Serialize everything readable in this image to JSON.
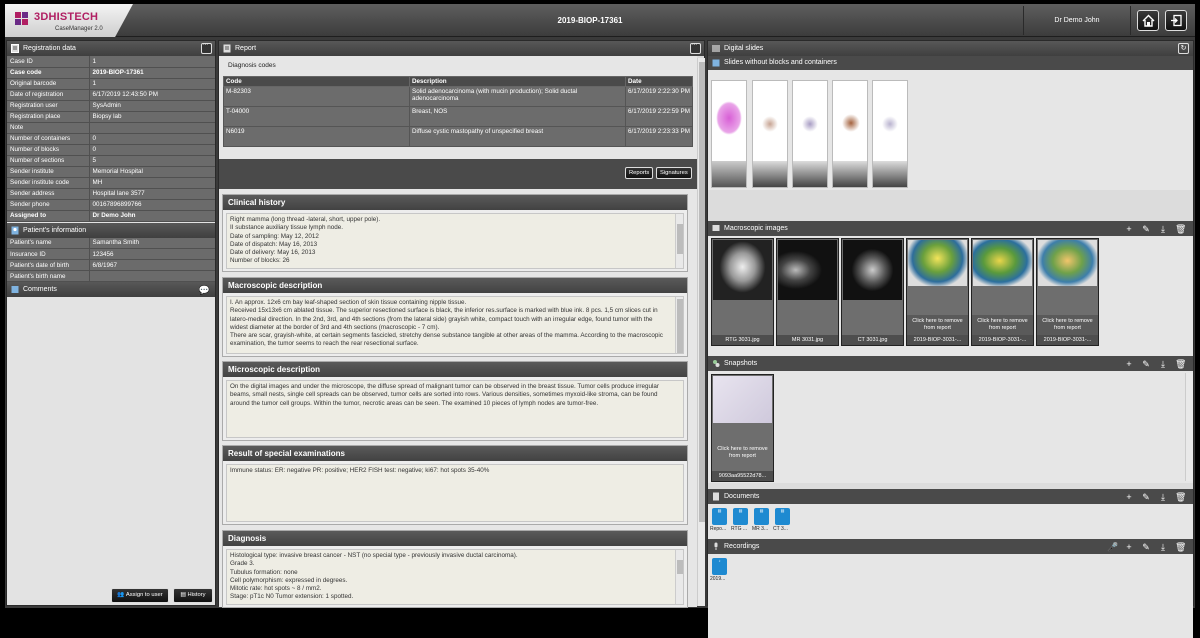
{
  "app": {
    "brand": "3DHISTECH",
    "product": "CaseManager 2.0",
    "case_title": "2019-BIOP-17361",
    "user": "Dr Demo John"
  },
  "registration": {
    "title": "Registration data",
    "rows": [
      {
        "k": "Case ID",
        "v": "1"
      },
      {
        "k": "Case code",
        "v": "2019-BIOP-17361",
        "bold": true
      },
      {
        "k": "Original barcode",
        "v": "1"
      },
      {
        "k": "Date of registration",
        "v": "6/17/2019 12:43:50 PM"
      },
      {
        "k": "Registration user",
        "v": "SysAdmin"
      },
      {
        "k": "Registration place",
        "v": "Biopsy lab"
      },
      {
        "k": "Note",
        "v": ""
      },
      {
        "k": "Number of containers",
        "v": "0"
      },
      {
        "k": "Number of blocks",
        "v": "0"
      },
      {
        "k": "Number of sections",
        "v": "5"
      },
      {
        "k": "Sender institute",
        "v": "Memorial Hospital"
      },
      {
        "k": "Sender institute code",
        "v": "MH"
      },
      {
        "k": "Sender address",
        "v": "Hospital lane 3577"
      },
      {
        "k": "Sender phone",
        "v": "00167896899766"
      },
      {
        "k": "Assigned to",
        "v": "Dr Demo John",
        "bold": true
      }
    ]
  },
  "patient": {
    "title": "Patient's information",
    "rows": [
      {
        "k": "Patient's name",
        "v": "Samantha Smith"
      },
      {
        "k": "Insurance ID",
        "v": "123456"
      },
      {
        "k": "Patient's date of birth",
        "v": "6/8/1967"
      },
      {
        "k": "Patient's birth name",
        "v": ""
      }
    ]
  },
  "comments": {
    "title": "Comments"
  },
  "bottom_buttons": {
    "assign": "Assign to user",
    "history": "History"
  },
  "report": {
    "title": "Report",
    "diag_codes_title": "Diagnosis codes",
    "columns": [
      "Code",
      "Description",
      "Date"
    ],
    "codes": [
      {
        "code": "M-82303",
        "desc": "Solid adenocarcinoma (with mucin production); Solid ductal adenocarcinoma",
        "date": "6/17/2019 2:22:30 PM"
      },
      {
        "code": "T-04000",
        "desc": "Breast, NOS",
        "date": "6/17/2019 2:22:59 PM"
      },
      {
        "code": "N6019",
        "desc": "Diffuse cystic mastopathy of unspecified breast",
        "date": "6/17/2019 2:23:33 PM"
      }
    ],
    "reports_btn": "Reports",
    "signatures_btn": "Signatures",
    "sections": [
      {
        "title": "Clinical history",
        "text": "Right mamma (long thread -lateral, short, upper pole).\nII substance auxiliary tissue lymph node.\nDate of sampling: May 12, 2012\nDate of dispatch: May 16, 2013\nDate of delivery: May 16, 2013\nNumber of blocks: 26"
      },
      {
        "title": "Macroscopic description",
        "text": "I. An approx. 12x6 cm bay leaf-shaped section of skin tissue containing nipple tissue.\nReceived 15x13x6 cm ablated tissue. The superior resectioned surface is black, the inferior res.surface is marked with blue ink. 8 pcs. 1,5 cm slices cut in latero-medial direction. In the 2nd, 3rd, and 4th sections (from the lateral side) grayish white, compact touch with an irregular edge, found tumor with the widest diameter at the border of 3rd and 4th sections (macroscopic - 7 cm).\nThere are scar, grayish-white, at certain segments fascicled, stretchy dense substance tangible at other areas of the mamma. According to the macroscopic examination, the tumor seems to reach the rear resectional surface."
      },
      {
        "title": "Microscopic description",
        "text": "On the digital images and under the microscope, the diffuse spread of malignant tumor can be observed in the breast tissue.  Tumor cells produce irregular beams, small nests, single cell spreads can be observed, tumor cells are sorted into rows. Various densities, sometimes myxoid-like stroma, can be found around the tumor cell groups. Within the tumor, necrotic areas can be seen. The examined 10 pieces of lymph nodes are tumor-free."
      },
      {
        "title": "Result of special examinations",
        "text": "Immune status: ER: negative PR: positive; HER2 FISH test: negative; ki67: hot spots 35-40%"
      },
      {
        "title": "Diagnosis",
        "text": "Histological type: invasive breast cancer - NST (no special type - previously invasive ductal carcinoma).\n Grade 3.\nTubulus formation: none\nCell polymorphism: expressed in degrees.\nMitotic rate: hot spots ~ 8 / mm2.\nStage: pT1c N0 Tumor extension: 1 spotted."
      }
    ]
  },
  "right": {
    "digital_slides": "Digital slides",
    "slides_without": "Slides without blocks and containers",
    "macro_title": "Macroscopic images",
    "macro_images": [
      "RTG 3031.jpg",
      "MR 3031.jpg",
      "CT 3031.jpg",
      "2019-BIOP-3031-...",
      "2019-BIOP-3031-...",
      "2019-BIOP-3031-..."
    ],
    "remove_text": "Click here to remove from report",
    "snapshots_title": "Snapshots",
    "snapshot_label": "9093aa95522d78...",
    "documents_title": "Documents",
    "documents": [
      "Repo...",
      "RTG ...",
      "MR 3...",
      "CT 3..."
    ],
    "recordings_title": "Recordings",
    "recordings": [
      "2019..."
    ]
  }
}
